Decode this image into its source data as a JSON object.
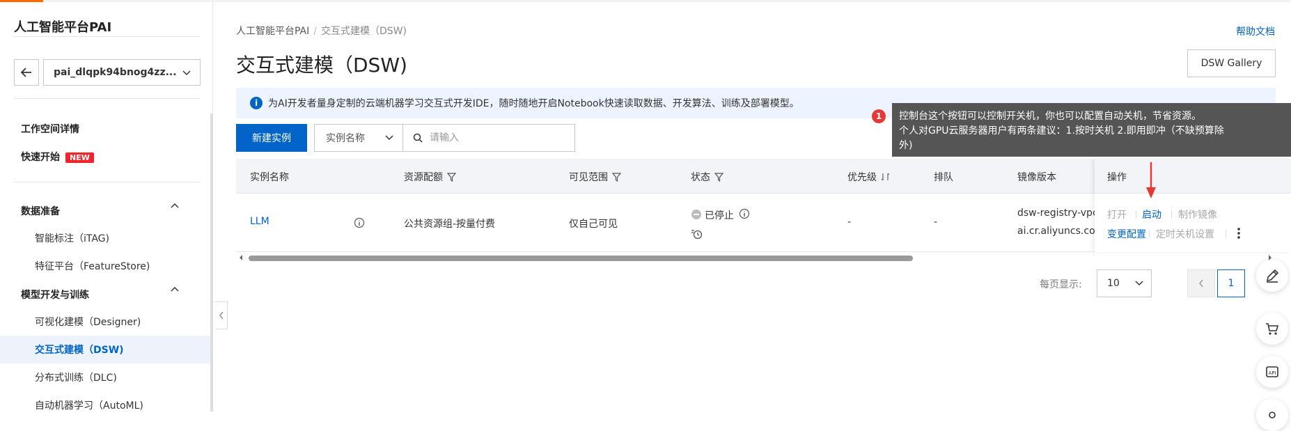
{
  "sidebar": {
    "title": "人工智能平台PAI",
    "workspace": "pai_dlqpk94bnog4zz...",
    "items": [
      {
        "label": "工作空间详情"
      },
      {
        "label": "快速开始",
        "badge": "NEW"
      }
    ],
    "sections": [
      {
        "label": "数据准备",
        "items": [
          "智能标注（iTAG)",
          "特征平台（FeatureStore)"
        ]
      },
      {
        "label": "模型开发与训练",
        "items": [
          "可视化建模（Designer)",
          "交互式建模（DSW)",
          "分布式训练（DLC)",
          "自动机器学习（AutoML)"
        ]
      }
    ]
  },
  "header": {
    "breadcrumb": [
      "人工智能平台PAI",
      "交互式建模（DSW)"
    ],
    "help_link": "帮助文档",
    "title": "交互式建模（DSW)",
    "gallery_button": "DSW Gallery"
  },
  "info_bar": "为AI开发者量身定制的云端机器学习交互式开发IDE，随时随地开启Notebook快速读取数据、开发算法、训练及部署模型。",
  "toolbar": {
    "new_button": "新建实例",
    "filter_select": "实例名称",
    "search_placeholder": "请输入"
  },
  "table": {
    "columns": [
      "实例名称",
      "资源配额",
      "可见范围",
      "状态",
      "优先级",
      "排队",
      "镜像版本",
      "操作"
    ],
    "rows": [
      {
        "name": "LLM",
        "quota": "公共资源组-按量付费",
        "visibility": "仅自己可见",
        "status": "已停止",
        "priority": "-",
        "queue": "-",
        "image_line1": "dsw-registry-vpc",
        "image_line2": "ai.cr.aliyuncs.com",
        "actions": {
          "open": "打开",
          "start": "启动",
          "make_image": "制作镜像",
          "change_config": "变更配置",
          "schedule_off": "定时关机设置"
        }
      }
    ]
  },
  "pagination": {
    "label": "每页显示:",
    "page_size": "10",
    "current_page": "1"
  },
  "tooltip": {
    "badge": "1",
    "line1": "控制台这个按钮可以控制开关机，你也可以配置自动关机，节省资源。",
    "line2": "个人对GPU云服务器用户有两条建议：1.按时关机 2.即用即冲（不缺预算除",
    "line3": "外)"
  },
  "colors": {
    "primary": "#0064c8",
    "accent": "#ff6a00",
    "badge_red": "#e53935"
  }
}
